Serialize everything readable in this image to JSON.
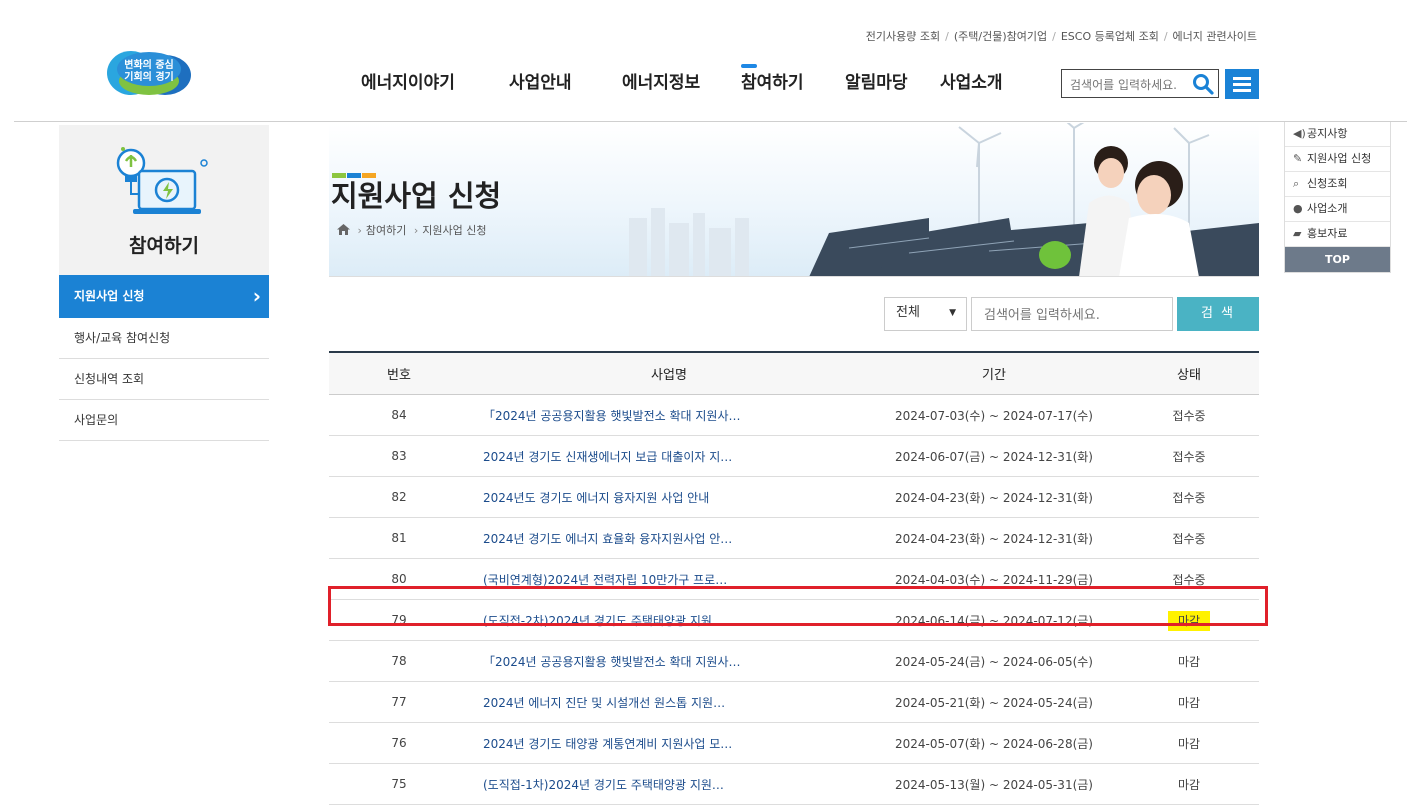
{
  "header": {
    "logo_line1": "변화의 중심",
    "logo_line2": "기회의 경기",
    "util_links": [
      "전기사용량 조회",
      "(주택/건물)참여기업",
      "ESCO 등록업체 조회",
      "에너지 관련사이트"
    ],
    "gnb": [
      "에너지이야기",
      "사업안내",
      "에너지정보",
      "참여하기",
      "알림마당",
      "사업소개"
    ],
    "gnb_active": "참여하기",
    "search_placeholder": "검색어를 입력하세요."
  },
  "sidebar": {
    "title": "참여하기",
    "items": [
      {
        "label": "지원사업 신청",
        "active": true
      },
      {
        "label": "행사/교육 참여신청",
        "active": false
      },
      {
        "label": "신청내역 조회",
        "active": false
      },
      {
        "label": "사업문의",
        "active": false
      }
    ]
  },
  "visual": {
    "title": "지원사업 신청",
    "breadcrumb": [
      "참여하기",
      "지원사업 신청"
    ]
  },
  "quick_menu": {
    "items": [
      "공지사항",
      "지원사업 신청",
      "신청조회",
      "사업소개",
      "홍보자료"
    ],
    "top_label": "TOP"
  },
  "board_search": {
    "select_value": "전체",
    "input_placeholder": "검색어를 입력하세요.",
    "button_label": "검 색"
  },
  "table": {
    "headers": [
      "번호",
      "사업명",
      "기간",
      "상태"
    ],
    "rows": [
      {
        "no": "84",
        "title": "「2024년 공공용지활용 햇빛발전소 확대 지원사…",
        "period": "2024-07-03(수) ~ 2024-07-17(수)",
        "status": "접수중"
      },
      {
        "no": "83",
        "title": "2024년 경기도 신재생에너지 보급 대출이자 지…",
        "period": "2024-06-07(금) ~ 2024-12-31(화)",
        "status": "접수중"
      },
      {
        "no": "82",
        "title": "2024년도 경기도 에너지 융자지원 사업 안내",
        "period": "2024-04-23(화) ~ 2024-12-31(화)",
        "status": "접수중"
      },
      {
        "no": "81",
        "title": "2024년 경기도 에너지 효율화 융자지원사업 안…",
        "period": "2024-04-23(화) ~ 2024-12-31(화)",
        "status": "접수중"
      },
      {
        "no": "80",
        "title": "(국비연계형)2024년 전력자립 10만가구 프로…",
        "period": "2024-04-03(수) ~ 2024-11-29(금)",
        "status": "접수중"
      },
      {
        "no": "79",
        "title": "(도직접-2차)2024년 경기도 주택태양광 지원…",
        "period": "2024-06-14(금) ~ 2024-07-12(금)",
        "status": "마감"
      },
      {
        "no": "78",
        "title": "「2024년 공공용지활용 햇빛발전소 확대 지원사…",
        "period": "2024-05-24(금) ~ 2024-06-05(수)",
        "status": "마감"
      },
      {
        "no": "77",
        "title": "2024년 에너지 진단 및 시설개선 원스톱 지원…",
        "period": "2024-05-21(화) ~ 2024-05-24(금)",
        "status": "마감"
      },
      {
        "no": "76",
        "title": "2024년 경기도 태양광 계통연계비 지원사업 모…",
        "period": "2024-05-07(화) ~ 2024-06-28(금)",
        "status": "마감"
      },
      {
        "no": "75",
        "title": "(도직접-1차)2024년 경기도 주택태양광 지원…",
        "period": "2024-05-13(월) ~ 2024-05-31(금)",
        "status": "마감"
      }
    ]
  },
  "colors": {
    "accent": "#1b82d4",
    "search_button": "#4ab3c4",
    "highlight_box": "#e0202a",
    "status_highlight": "#fff200"
  }
}
